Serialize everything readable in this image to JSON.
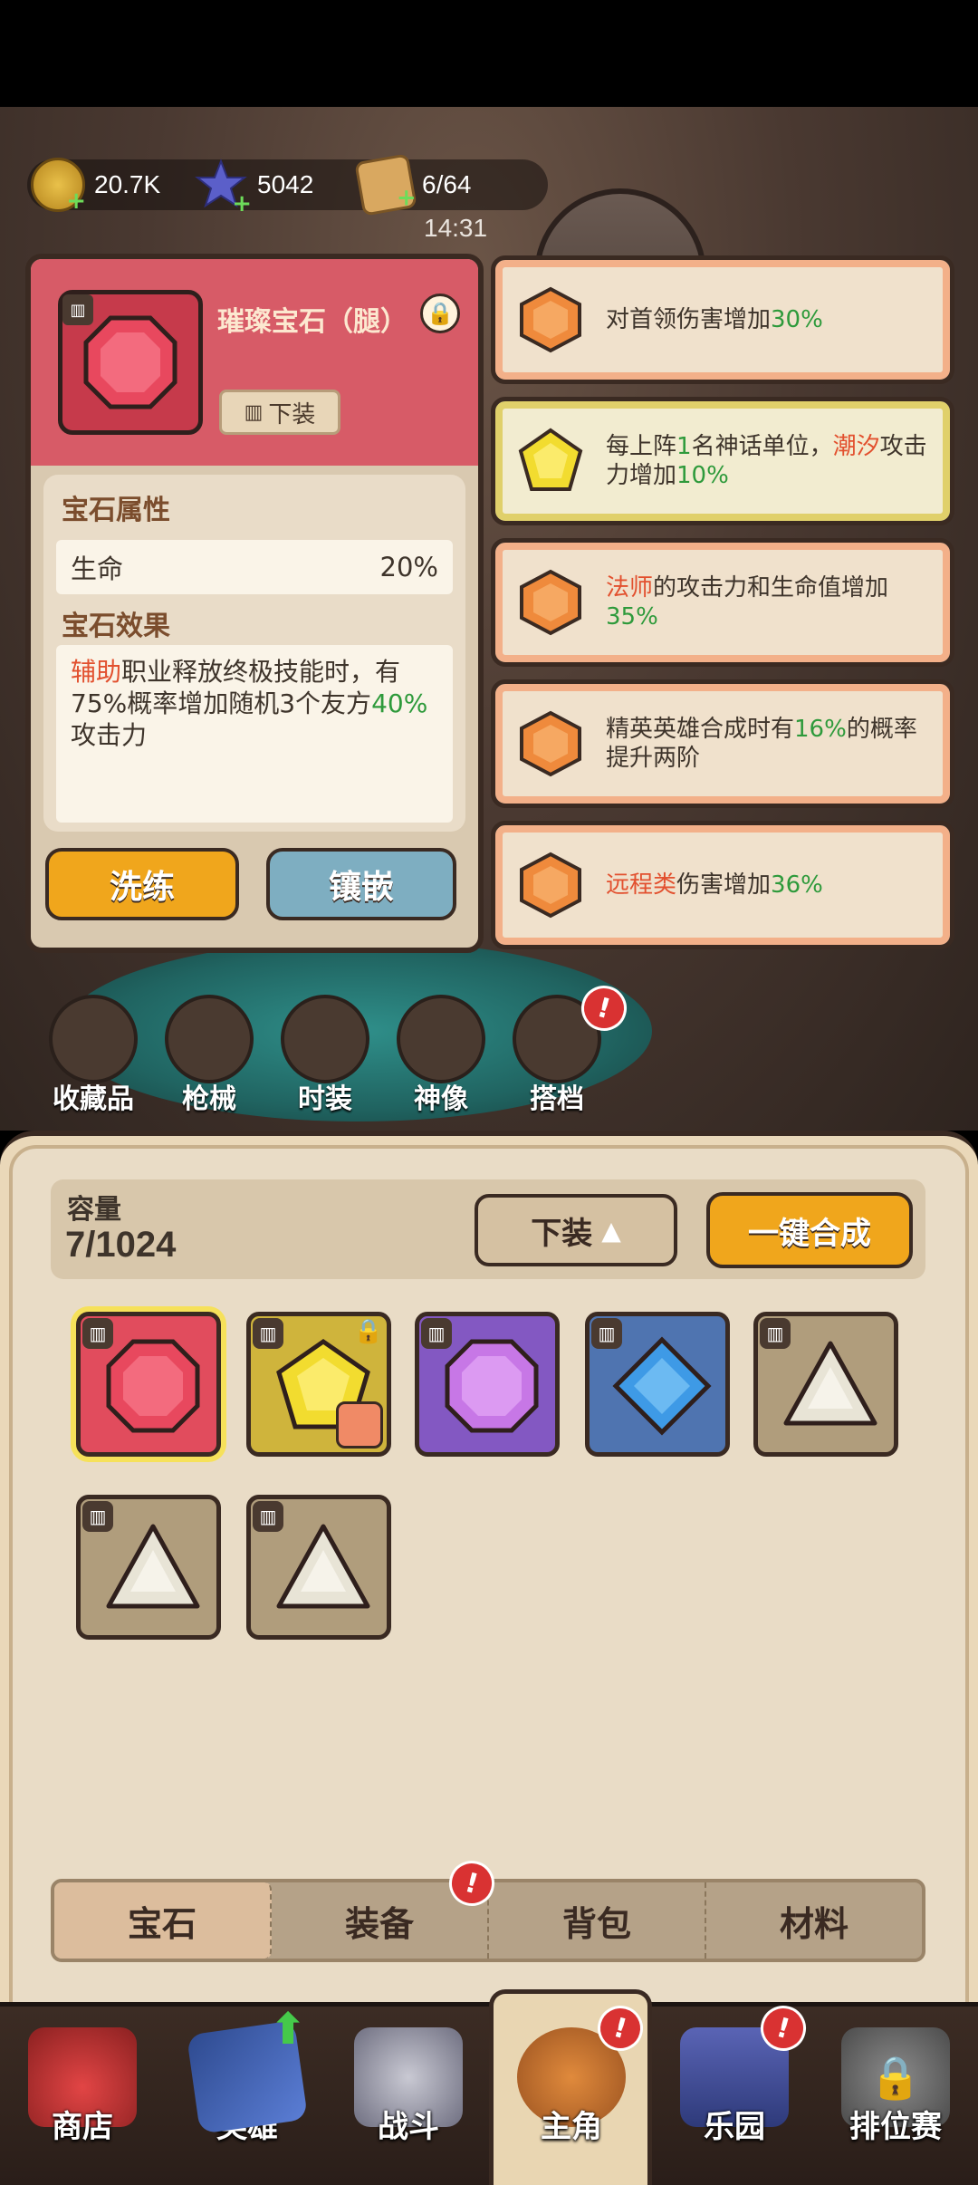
{
  "status": {
    "time": "14:31"
  },
  "resources": [
    {
      "name": "coin",
      "icon": "coin-icon",
      "value": "20.7K"
    },
    {
      "name": "star",
      "icon": "star-icon",
      "value": "5042"
    },
    {
      "name": "cracker",
      "icon": "cracker-icon",
      "value": "6/64"
    }
  ],
  "gem_detail": {
    "name": "璀璨宝石（腿）",
    "unequip_tag": "下装",
    "attr_title": "宝石属性",
    "attr_name": "生命",
    "attr_value": "20%",
    "effect_title": "宝石效果",
    "effect_parts": [
      "辅助",
      "职业释放终极技能时，有75%概率增加随机3个友方",
      "40%",
      "攻击力"
    ],
    "refine_label": "洗练",
    "inlay_label": "镶嵌"
  },
  "effects_list": [
    {
      "color": "orange",
      "parts": [
        "对首领伤害增加",
        "30%"
      ]
    },
    {
      "color": "yellow",
      "parts": [
        "每上阵",
        "1",
        "名神话单位，",
        "潮汐",
        "攻击力增加",
        "10%"
      ]
    },
    {
      "color": "orange",
      "parts": [
        "法师",
        "的攻击力和生命值增加",
        "35%"
      ]
    },
    {
      "color": "orange",
      "parts": [
        "精英英雄合成时有",
        "16%",
        "的概率提升两阶"
      ]
    },
    {
      "color": "orange",
      "parts": [
        "远程类",
        "伤害增加",
        "36%"
      ]
    }
  ],
  "side_nav": [
    "收藏品",
    "枪械",
    "时装",
    "神像",
    "搭档"
  ],
  "bag": {
    "capacity_label": "容量",
    "capacity_value": "7/1024",
    "unequip_label": "下装",
    "merge_label": "一键合成",
    "slots": [
      {
        "gem": "red",
        "selected": true
      },
      {
        "gem": "yellow",
        "locked": true
      },
      {
        "gem": "purple"
      },
      {
        "gem": "blue"
      },
      {
        "gem": "white"
      },
      {
        "gem": "white"
      },
      {
        "gem": "white"
      }
    ],
    "tabs": [
      "宝石",
      "装备",
      "背包",
      "材料"
    ]
  },
  "bottom_nav": [
    "商店",
    "英雄",
    "战斗",
    "主角",
    "乐园",
    "排位赛"
  ],
  "colors": {
    "accent": "#f0a61c",
    "alert": "#d93232",
    "green": "#2e9a3b",
    "red": "#e2502e"
  }
}
